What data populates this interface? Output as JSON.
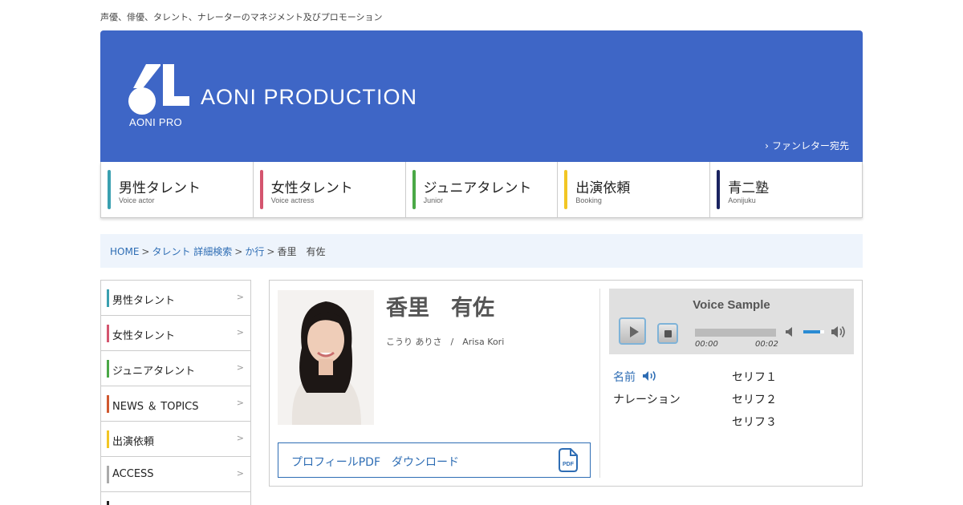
{
  "tagline": "声優、俳優、タレント、ナレーターのマネジメント及びプロモーション",
  "header": {
    "logo_sub": "AONI PRO",
    "logo_text": "AONI PRODUCTION",
    "fanletter": "ファンレター宛先",
    "bg_color": "#3e66c6"
  },
  "gnav": [
    {
      "label": "男性タレント",
      "sub": "Voice actor",
      "color": "#3aa0b0"
    },
    {
      "label": "女性タレント",
      "sub": "Voice actress",
      "color": "#d4556f"
    },
    {
      "label": "ジュニアタレント",
      "sub": "Junior",
      "color": "#4aa846"
    },
    {
      "label": "出演依頼",
      "sub": "Booking",
      "color": "#f2c624"
    },
    {
      "label": "青二塾",
      "sub": "Aonijuku",
      "color": "#1a2360"
    }
  ],
  "breadcrumb": {
    "home": "HOME",
    "search": "タレント 詳細検索",
    "row": "か行",
    "sep": ">",
    "current": "香里　有佐"
  },
  "side": [
    {
      "label": "男性タレント",
      "color": "#3aa0b0"
    },
    {
      "label": "女性タレント",
      "color": "#d4556f"
    },
    {
      "label": "ジュニアタレント",
      "color": "#4aa846"
    },
    {
      "label": "NEWS ＆ TOPICS",
      "color": "#d0582f"
    },
    {
      "label": "出演依頼",
      "color": "#f2c624"
    },
    {
      "label": "ACCESS",
      "color": "#aaaaaa"
    }
  ],
  "profile": {
    "name": "香里　有佐",
    "kana": "こうり ありさ　/　Arisa Kori",
    "pdf_label": "プロフィールPDF　ダウンロード",
    "pdf_icon_text": "PDF"
  },
  "player": {
    "title": "Voice Sample",
    "time_current": "00:00",
    "time_duration": "00:02",
    "volume_level": 0.8
  },
  "samples": {
    "category_name": "名前",
    "category_narration": "ナレーション",
    "lines": [
      "セリフ１",
      "セリフ２",
      "セリフ３"
    ]
  }
}
